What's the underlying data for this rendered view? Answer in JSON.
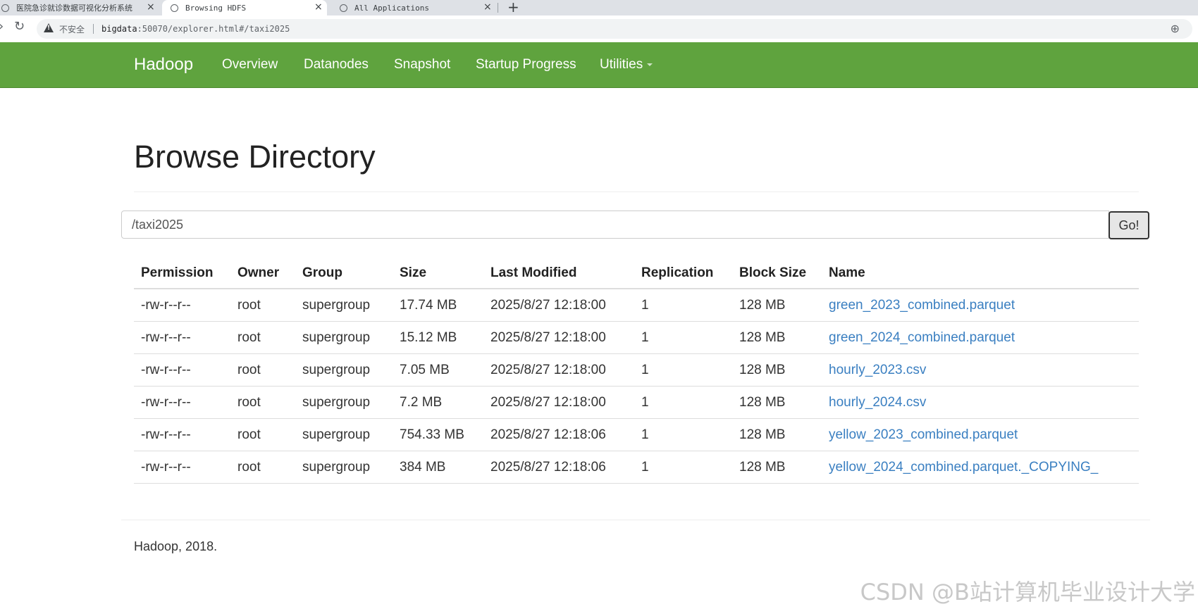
{
  "browser": {
    "tabs": [
      {
        "title": "医院急诊就诊数据可视化分析系统"
      },
      {
        "title": "Browsing HDFS"
      },
      {
        "title": "All Applications"
      }
    ],
    "close_glyph": "×",
    "new_tab_glyph": "+",
    "security_label": "不安全",
    "url_host": "bigdata",
    "url_rest": ":50070/explorer.html#/taxi2025"
  },
  "navbar": {
    "brand": "Hadoop",
    "items": [
      "Overview",
      "Datanodes",
      "Snapshot",
      "Startup Progress",
      "Utilities"
    ]
  },
  "page": {
    "title": "Browse Directory",
    "path_value": "/taxi2025",
    "go_label": "Go!"
  },
  "table": {
    "headers": [
      "Permission",
      "Owner",
      "Group",
      "Size",
      "Last Modified",
      "Replication",
      "Block Size",
      "Name"
    ],
    "rows": [
      [
        "-rw-r--r--",
        "root",
        "supergroup",
        "17.74 MB",
        "2025/8/27 12:18:00",
        "1",
        "128 MB",
        "green_2023_combined.parquet"
      ],
      [
        "-rw-r--r--",
        "root",
        "supergroup",
        "15.12 MB",
        "2025/8/27 12:18:00",
        "1",
        "128 MB",
        "green_2024_combined.parquet"
      ],
      [
        "-rw-r--r--",
        "root",
        "supergroup",
        "7.05 MB",
        "2025/8/27 12:18:00",
        "1",
        "128 MB",
        "hourly_2023.csv"
      ],
      [
        "-rw-r--r--",
        "root",
        "supergroup",
        "7.2 MB",
        "2025/8/27 12:18:00",
        "1",
        "128 MB",
        "hourly_2024.csv"
      ],
      [
        "-rw-r--r--",
        "root",
        "supergroup",
        "754.33 MB",
        "2025/8/27 12:18:06",
        "1",
        "128 MB",
        "yellow_2023_combined.parquet"
      ],
      [
        "-rw-r--r--",
        "root",
        "supergroup",
        "384 MB",
        "2025/8/27 12:18:06",
        "1",
        "128 MB",
        "yellow_2024_combined.parquet._COPYING_"
      ]
    ]
  },
  "footer": {
    "text": "Hadoop, 2018."
  },
  "watermark": "CSDN @B站计算机毕业设计大学"
}
